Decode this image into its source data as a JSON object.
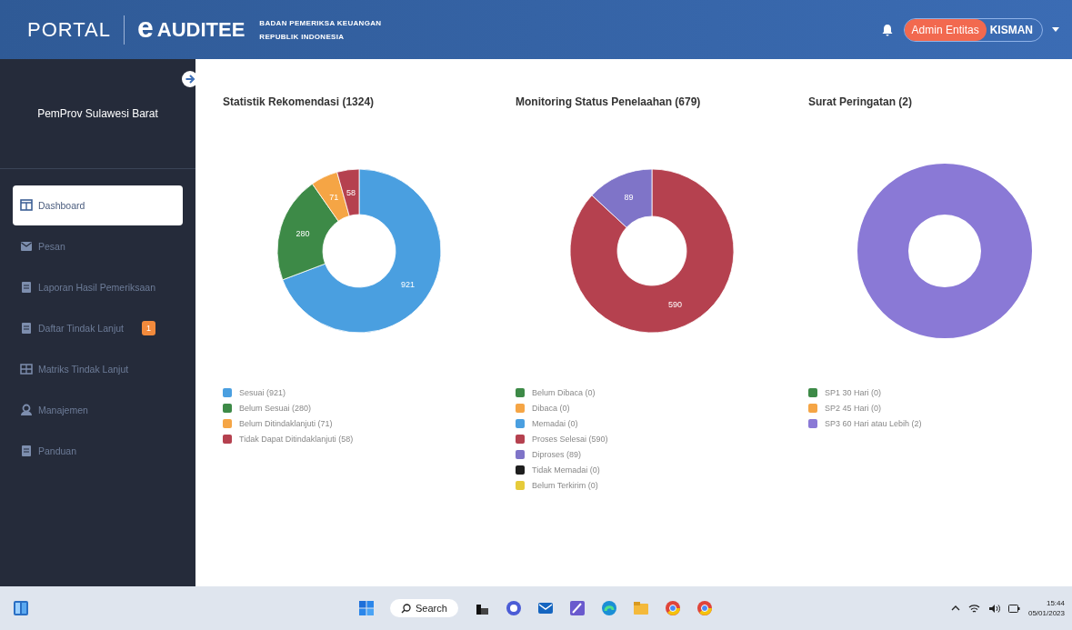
{
  "header": {
    "portal": "PORTAL",
    "logo_letter": "e",
    "brand": "AUDITEE",
    "org_line_1": "BADAN PEMERIKSA KEUANGAN",
    "org_line_2": "REPUBLIK INDONESIA",
    "role": "Admin Entitas",
    "user": "KISMAN"
  },
  "sidebar": {
    "title": "PemProv Sulawesi Barat",
    "items": [
      {
        "label": "Dashboard",
        "selected": true
      },
      {
        "label": "Pesan",
        "selected": false
      },
      {
        "label": "Laporan Hasil Pemeriksaan",
        "selected": false
      },
      {
        "label": "Daftar Tindak Lanjut",
        "selected": false,
        "badge": "1"
      },
      {
        "label": "Matriks Tindak Lanjut",
        "selected": false
      },
      {
        "label": "Manajemen",
        "selected": false
      },
      {
        "label": "Panduan",
        "selected": false
      }
    ]
  },
  "panels": [
    {
      "title": "Statistik Rekomendasi (1324)",
      "chart_data": {
        "type": "donut",
        "values": [
          921,
          280,
          71,
          58
        ],
        "data_labels": true
      },
      "legend": [
        {
          "label": "Sesuai (921)",
          "color": "#4a9fe0"
        },
        {
          "label": "Belum Sesuai (280)",
          "color": "#3d8a47"
        },
        {
          "label": "Belum Ditindaklanjuti (71)",
          "color": "#f5a545"
        },
        {
          "label": "Tidak Dapat Ditindaklanjuti (58)",
          "color": "#b5414f"
        }
      ]
    },
    {
      "title": "Monitoring Status Penelaahan (679)",
      "chart_data": {
        "type": "donut",
        "values": [
          0,
          0,
          0,
          590,
          89,
          0,
          0
        ],
        "data_labels": true
      },
      "legend": [
        {
          "label": "Belum Dibaca (0)",
          "color": "#3d8a47"
        },
        {
          "label": "Dibaca (0)",
          "color": "#f5a545"
        },
        {
          "label": "Memadai (0)",
          "color": "#4a9fe0"
        },
        {
          "label": "Proses Selesai (590)",
          "color": "#b5414f"
        },
        {
          "label": "Diproses (89)",
          "color": "#7f74c8"
        },
        {
          "label": "Tidak Memadai (0)",
          "color": "#1e1e1e"
        },
        {
          "label": "Belum Terkirim (0)",
          "color": "#e6cb3a"
        }
      ]
    },
    {
      "title": "Surat Peringatan (2)",
      "legend": [
        {
          "label": "SP1 30 Hari (0)",
          "color": "#3d8a47"
        },
        {
          "label": "SP2 45 Hari (0)",
          "color": "#f5a545"
        },
        {
          "label": "SP3 60 Hari atau Lebih (2)",
          "color": "#8a79d6"
        }
      ]
    }
  ],
  "taskbar": {
    "search": "Search",
    "time": "15:44",
    "date": "05/01/2023"
  }
}
